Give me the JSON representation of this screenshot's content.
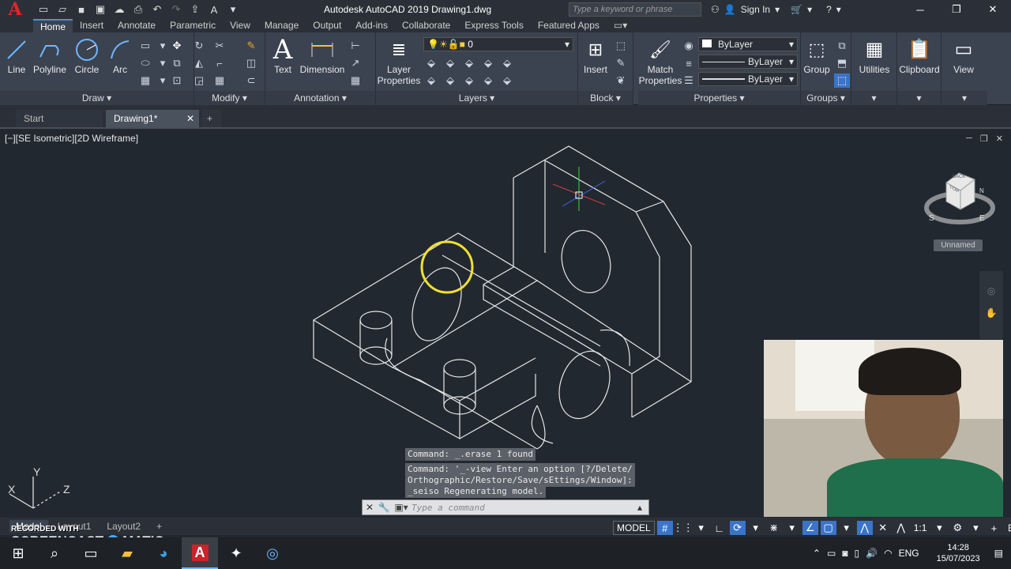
{
  "app": {
    "logo_letter": "A",
    "title": "Autodesk AutoCAD 2019   Drawing1.dwg",
    "search_placeholder": "Type a keyword or phrase",
    "sign_in": "Sign In"
  },
  "tabs": [
    "Home",
    "Insert",
    "Annotate",
    "Parametric",
    "View",
    "Manage",
    "Output",
    "Add-ins",
    "Collaborate",
    "Express Tools",
    "Featured Apps"
  ],
  "ribbon": {
    "draw": {
      "title": "Draw",
      "line": "Line",
      "polyline": "Polyline",
      "circle": "Circle",
      "arc": "Arc"
    },
    "modify": {
      "title": "Modify"
    },
    "annotation": {
      "title": "Annotation",
      "text": "Text",
      "dimension": "Dimension"
    },
    "layers": {
      "title": "Layers",
      "layer_properties_1": "Layer",
      "layer_properties_2": "Properties",
      "current_layer": "0"
    },
    "block": {
      "title": "Block",
      "insert": "Insert"
    },
    "properties": {
      "title": "Properties",
      "match_1": "Match",
      "match_2": "Properties",
      "color": "ByLayer",
      "linetype": "ByLayer",
      "lineweight": "ByLayer"
    },
    "groups": {
      "title": "Groups",
      "group": "Group"
    },
    "utilities": "Utilities",
    "clipboard": "Clipboard",
    "view": "View"
  },
  "doc_tabs": {
    "start": "Start",
    "drawing": "Drawing1*"
  },
  "viewport": {
    "label": "[−][SE Isometric][2D Wireframe]",
    "viewcube_top": "TOP",
    "viewcube_back": "BACK",
    "viewcube_s": "S",
    "viewcube_e": "E",
    "viewcube_n": "N",
    "ucs_name": "Unnamed",
    "axis_x": "X",
    "axis_y": "Y",
    "axis_z": "Z"
  },
  "command": {
    "hist1": "Command: _.erase 1 found",
    "hist2": "Command: '_-view Enter an option [?/Delete/",
    "hist3": "Orthographic/Restore/Save/sEttings/Window]:",
    "hist4": "_seiso Regenerating model.",
    "placeholder": "Type a command"
  },
  "layouts": [
    "Model",
    "Layout1",
    "Layout2"
  ],
  "status": {
    "model": "MODEL",
    "scale": "1:1"
  },
  "taskbar": {
    "lang": "ENG",
    "time": "14:28",
    "date": "15/07/2023"
  },
  "watermark": {
    "line1": "RECORDED WITH",
    "line2": "SCREENCAST",
    "line3": "MATIC"
  }
}
